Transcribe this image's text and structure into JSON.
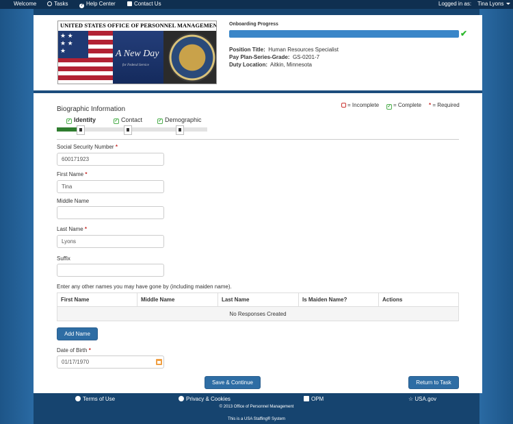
{
  "topnav": {
    "welcome": "Welcome",
    "tasks": "Tasks",
    "help": "Help Center",
    "contact": "Contact Us",
    "logged_in_label": "Logged in as:",
    "user": "Tina Lyons"
  },
  "header": {
    "logo": {
      "title": "United States Office of Personnel Management",
      "script": "A New Day",
      "subtitle": "for Federal Service"
    },
    "progress_label": "Onboarding Progress",
    "progress_fraction": 1.0,
    "position_title_label": "Position Title:",
    "position_title_value": "Human Resources Specialist",
    "pay_plan_label": "Pay Plan-Series-Grade:",
    "pay_plan_value": "GS-0201-7",
    "duty_location_label": "Duty Location:",
    "duty_location_value": "Aitkin, Minnesota"
  },
  "section": {
    "title": "Biographic Information",
    "legend_incomplete": "= Incomplete",
    "legend_complete": "= Complete",
    "legend_required": "= Required",
    "steps": [
      "Identity",
      "Contact",
      "Demographic"
    ]
  },
  "form": {
    "ssn_label": "Social Security Number",
    "ssn_value": "600171923",
    "first_name_label": "First Name",
    "first_name_value": "Tina",
    "middle_name_label": "Middle Name",
    "middle_name_value": "",
    "last_name_label": "Last Name",
    "last_name_value": "Lyons",
    "suffix_label": "Suffix",
    "suffix_value": "",
    "other_names_prompt": "Enter any other names you may have gone by (including maiden name).",
    "table_headers": [
      "First Name",
      "Middle Name",
      "Last Name",
      "Is Maiden Name?",
      "Actions"
    ],
    "table_empty": "No Responses Created",
    "add_name": "Add Name",
    "dob_label": "Date of Birth",
    "dob_value": "01/17/1970",
    "save_continue": "Save & Continue",
    "return_to_task": "Return to Task"
  },
  "footer": {
    "terms": "Terms of Use",
    "privacy": "Privacy & Cookies",
    "opm": "OPM",
    "usagov": "USA.gov",
    "copyright": "© 2013 Office of Personnel Management",
    "system": "This is a USA Staffing® System"
  },
  "colors": {
    "nav_bg": "#0f2f50",
    "accent_blue": "#2e6da4",
    "progress_blue": "#3a86c8",
    "complete_green": "#4cae4c",
    "required_red": "#c9302c"
  }
}
